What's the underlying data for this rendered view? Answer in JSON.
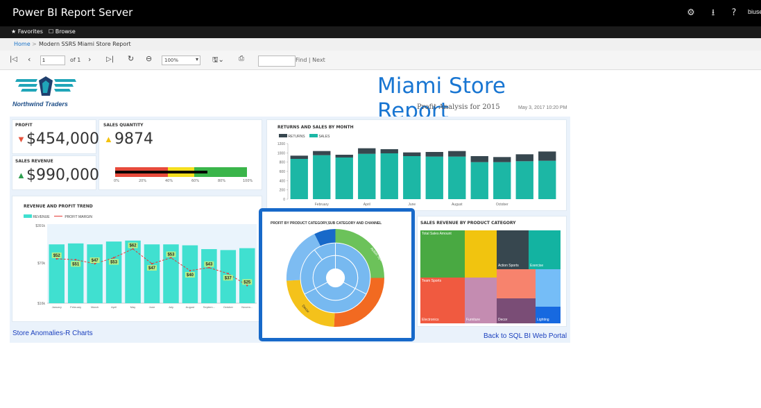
{
  "app": {
    "title": "Power BI Report Server",
    "user": "biuse",
    "icons": [
      "gear-icon",
      "download-icon",
      "help-icon"
    ]
  },
  "nav": {
    "favorites": "Favorites",
    "browse": "Browse"
  },
  "breadcrumb": {
    "home": "Home",
    "separator": ">",
    "current": "Modern SSRS Miami Store Report"
  },
  "toolbar": {
    "page_value": "1",
    "page_of": "of 1",
    "zoom": "100%",
    "find_value": "",
    "find_next": "Find | Next"
  },
  "report": {
    "logo_text": "Northwind Traders",
    "title": "Miami Store Report",
    "subtitle": "Profit Analysis for 2015",
    "timestamp": "May 3, 2017 10:20 PM",
    "profit_label": "PROFIT",
    "profit_value": "$454,000",
    "sales_qty_label": "SALES QUANTITY",
    "sales_qty_value": "9874",
    "sales_revenue_label": "SALES REVENUE",
    "sales_revenue_value": "$990,000",
    "bullet_ticks": [
      "0%",
      "20%",
      "40%",
      "60%",
      "80%",
      "100%"
    ],
    "bullet_progress": 0.7,
    "returns_title": "RETURNS AND SALES BY MONTH",
    "returns_legend": [
      "RETURNS",
      "SALES"
    ],
    "trend_title": "REVENUE AND PROFIT TREND",
    "trend_legend": [
      "REVENUE",
      "PROFIT MARGIN"
    ],
    "sunburst_title": "PROFIT BY PRODUCT CATEGORY,SUB CATEGORY AND CHANNEL",
    "treemap_title": "SALES REVENUE  BY PRODUCT CATEGORY",
    "link_left": "Store Anomalies-R Charts",
    "link_right": "Back to SQL BI Web Portal",
    "colors": {
      "accent": "#1769c9",
      "teal": "#1cb7a5",
      "dark": "#37474f",
      "up": "#2e9e4f",
      "down": "#e5533d",
      "warn": "#f4c20d"
    }
  },
  "chart_data": [
    {
      "type": "bar",
      "title": "RETURNS AND SALES BY MONTH",
      "categories": [
        "January",
        "February",
        "March",
        "April",
        "May",
        "June",
        "July",
        "August",
        "September",
        "October",
        "November",
        "December"
      ],
      "tick_labels": [
        "February",
        "April",
        "June",
        "August",
        "October"
      ],
      "ylim": [
        0,
        1200
      ],
      "yticks": [
        "1200",
        "1000",
        "800",
        "600",
        "400",
        "200",
        "0"
      ],
      "series": [
        {
          "name": "SALES",
          "values": [
            870,
            950,
            900,
            980,
            990,
            930,
            920,
            920,
            800,
            800,
            820,
            830
          ]
        },
        {
          "name": "RETURNS",
          "values": [
            70,
            90,
            60,
            120,
            90,
            80,
            100,
            120,
            130,
            110,
            150,
            200
          ]
        }
      ]
    },
    {
      "type": "bar",
      "title": "REVENUE AND PROFIT TREND",
      "categories": [
        "January",
        "February",
        "March",
        "April",
        "May",
        "June",
        "July",
        "August",
        "Septem...",
        "October",
        "Novem..."
      ],
      "yticks": [
        "$391k",
        "$70k",
        "$16k"
      ],
      "series": [
        {
          "name": "REVENUE",
          "values": [
            62,
            63,
            62,
            65,
            66,
            62,
            62,
            61,
            57,
            56,
            58
          ]
        },
        {
          "name": "PROFIT MARGIN",
          "values": [
            52,
            51,
            47,
            53,
            62,
            47,
            53,
            40,
            43,
            37,
            25
          ],
          "labels": [
            "$52",
            "$51",
            "$47",
            "$53",
            "$62",
            "$47",
            "$53",
            "$40",
            "$43",
            "$37",
            "$25"
          ]
        }
      ]
    },
    {
      "type": "pie",
      "title": "PROFIT BY PRODUCT CATEGORY,SUB CATEGORY AND CHANNEL",
      "categories": [
        "Action Sports",
        "Electronics",
        "Decor",
        "Lighting"
      ]
    },
    {
      "type": "heatmap",
      "title": "SALES REVENUE  BY PRODUCT CATEGORY",
      "categories": [
        "Total Sales Amount",
        "Team Sports",
        "Electronics",
        "Furniture",
        "Action Sports",
        "Exercise",
        "Decor",
        "Lighting"
      ]
    }
  ]
}
